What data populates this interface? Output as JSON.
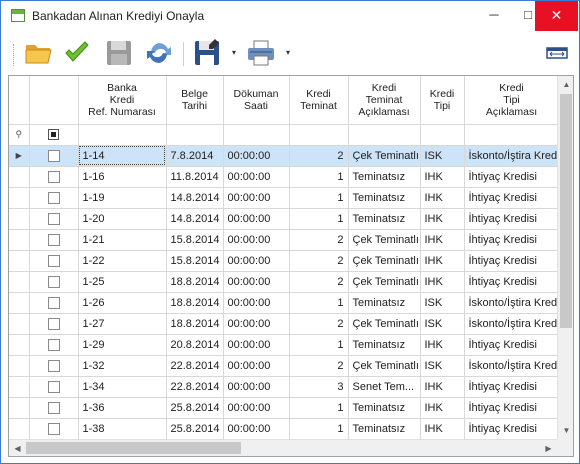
{
  "window": {
    "title": "Bankadan Alınan Krediyi Onayla",
    "minimize": "─",
    "maximize": "□",
    "close": "✕"
  },
  "toolbar": {
    "buttons": [
      {
        "name": "open-folder-icon"
      },
      {
        "name": "checkmark-icon"
      },
      {
        "name": "save-icon"
      },
      {
        "name": "refresh-icon"
      },
      {
        "name": "save-as-icon"
      },
      {
        "name": "printer-icon"
      },
      {
        "name": "column-width-icon"
      }
    ],
    "dropdown_glyph": "▾"
  },
  "grid": {
    "columns": [
      {
        "line1": "",
        "line2": "",
        "line3": ""
      },
      {
        "line1": "",
        "line2": "",
        "line3": ""
      },
      {
        "line1": "Banka",
        "line2": "Kredi",
        "line3": "Ref. Numarası"
      },
      {
        "line1": "Belge",
        "line2": "Tarihi",
        "line3": ""
      },
      {
        "line1": "Dökuman",
        "line2": "Saati",
        "line3": ""
      },
      {
        "line1": "Kredi",
        "line2": "Teminat",
        "line3": ""
      },
      {
        "line1": "Kredi",
        "line2": "Teminat",
        "line3": "Açıklaması"
      },
      {
        "line1": "Kredi",
        "line2": "Tipi",
        "line3": ""
      },
      {
        "line1": "Kredi",
        "line2": "Tipi",
        "line3": "Açıklaması"
      }
    ],
    "filter_row_icon": "⚲",
    "rows": [
      {
        "ref": "1-14",
        "date": "7.8.2014",
        "time": "00:00:00",
        "teminat": "2",
        "teminat_desc": "Çek Teminatlı",
        "tip": "ISK",
        "tip_desc": "İskonto/İştira Kredi",
        "selected": true
      },
      {
        "ref": "1-16",
        "date": "11.8.2014",
        "time": "00:00:00",
        "teminat": "1",
        "teminat_desc": "Teminatsız",
        "tip": "IHK",
        "tip_desc": "İhtiyaç Kredisi"
      },
      {
        "ref": "1-19",
        "date": "14.8.2014",
        "time": "00:00:00",
        "teminat": "1",
        "teminat_desc": "Teminatsız",
        "tip": "IHK",
        "tip_desc": "İhtiyaç Kredisi"
      },
      {
        "ref": "1-20",
        "date": "14.8.2014",
        "time": "00:00:00",
        "teminat": "1",
        "teminat_desc": "Teminatsız",
        "tip": "IHK",
        "tip_desc": "İhtiyaç Kredisi"
      },
      {
        "ref": "1-21",
        "date": "15.8.2014",
        "time": "00:00:00",
        "teminat": "2",
        "teminat_desc": "Çek Teminatlı",
        "tip": "IHK",
        "tip_desc": "İhtiyaç Kredisi"
      },
      {
        "ref": "1-22",
        "date": "15.8.2014",
        "time": "00:00:00",
        "teminat": "2",
        "teminat_desc": "Çek Teminatlı",
        "tip": "IHK",
        "tip_desc": "İhtiyaç Kredisi"
      },
      {
        "ref": "1-25",
        "date": "18.8.2014",
        "time": "00:00:00",
        "teminat": "2",
        "teminat_desc": "Çek Teminatlı",
        "tip": "IHK",
        "tip_desc": "İhtiyaç Kredisi"
      },
      {
        "ref": "1-26",
        "date": "18.8.2014",
        "time": "00:00:00",
        "teminat": "1",
        "teminat_desc": "Teminatsız",
        "tip": "ISK",
        "tip_desc": "İskonto/İştira Kredi"
      },
      {
        "ref": "1-27",
        "date": "18.8.2014",
        "time": "00:00:00",
        "teminat": "2",
        "teminat_desc": "Çek Teminatlı",
        "tip": "ISK",
        "tip_desc": "İskonto/İştira Kredi"
      },
      {
        "ref": "1-29",
        "date": "20.8.2014",
        "time": "00:00:00",
        "teminat": "1",
        "teminat_desc": "Teminatsız",
        "tip": "IHK",
        "tip_desc": "İhtiyaç Kredisi"
      },
      {
        "ref": "1-32",
        "date": "22.8.2014",
        "time": "00:00:00",
        "teminat": "2",
        "teminat_desc": "Çek Teminatlı",
        "tip": "ISK",
        "tip_desc": "İskonto/İştira Kredi"
      },
      {
        "ref": "1-34",
        "date": "22.8.2014",
        "time": "00:00:00",
        "teminat": "3",
        "teminat_desc": "Senet Tem...",
        "tip": "IHK",
        "tip_desc": "İhtiyaç Kredisi"
      },
      {
        "ref": "1-36",
        "date": "25.8.2014",
        "time": "00:00:00",
        "teminat": "1",
        "teminat_desc": "Teminatsız",
        "tip": "IHK",
        "tip_desc": "İhtiyaç Kredisi"
      },
      {
        "ref": "1-38",
        "date": "25.8.2014",
        "time": "00:00:00",
        "teminat": "1",
        "teminat_desc": "Teminatsız",
        "tip": "IHK",
        "tip_desc": "İhtiyaç Kredisi"
      }
    ]
  },
  "scrollbars": {
    "up": "▲",
    "down": "▼",
    "left": "◀",
    "right": "▶"
  }
}
